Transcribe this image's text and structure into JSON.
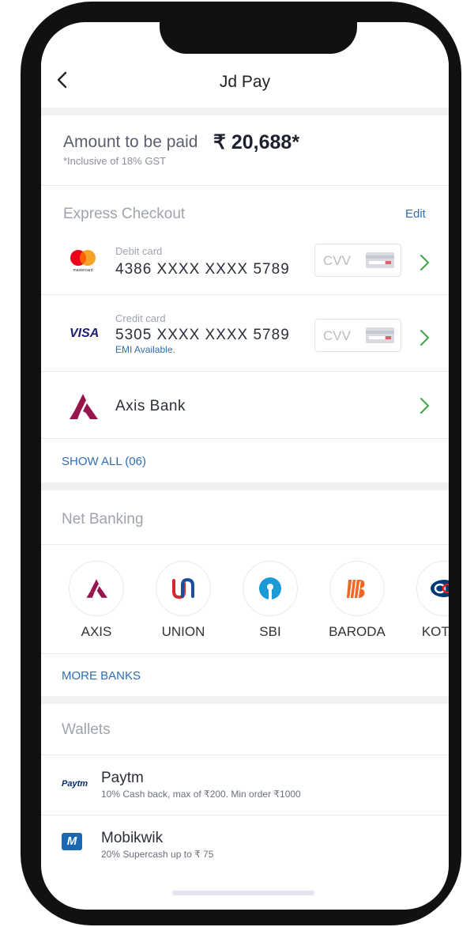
{
  "header": {
    "title": "Jd Pay"
  },
  "amount": {
    "label": "Amount to be paid",
    "value": "₹ 20,688*",
    "note": "*Inclusive of 18% GST"
  },
  "express_checkout": {
    "title": "Express Checkout",
    "edit_label": "Edit",
    "cards": [
      {
        "type": "Debit card",
        "number": "4386 XXXX XXXX 5789",
        "cvv_placeholder": "CVV",
        "network_icon": "mastercard-icon",
        "network_caption": "mastercard"
      },
      {
        "type": "Credit card",
        "number": "5305 XXXX XXXX 5789",
        "cvv_placeholder": "CVV",
        "emi": "EMI Available.",
        "network_icon": "visa-icon",
        "network_label": "VISA"
      }
    ],
    "bank": {
      "name": "Axis Bank",
      "icon": "axis-bank-icon"
    },
    "show_all": "SHOW ALL (06)"
  },
  "net_banking": {
    "title": "Net Banking",
    "banks": [
      {
        "label": "AXIS",
        "icon": "axis-logo-icon"
      },
      {
        "label": "UNION",
        "icon": "union-logo-icon"
      },
      {
        "label": "SBI",
        "icon": "sbi-logo-icon"
      },
      {
        "label": "BARODA",
        "icon": "baroda-logo-icon"
      },
      {
        "label": "KOTAK",
        "icon": "kotak-logo-icon"
      }
    ],
    "more_banks": "MORE BANKS"
  },
  "wallets": {
    "title": "Wallets",
    "items": [
      {
        "name": "Paytm",
        "desc": "10% Cash back, max of ₹200. Min order ₹1000",
        "logo_text": "Paytm",
        "icon": "paytm-logo-icon"
      },
      {
        "name": "Mobikwik",
        "desc": "20% Supercash up to ₹ 75",
        "logo_text": "M",
        "icon": "mobikwik-logo-icon"
      }
    ]
  },
  "colors": {
    "link_blue": "#2f6db3",
    "chevron_green": "#3aa845",
    "axis_maroon": "#97144d",
    "sbi_blue": "#1a9ad6",
    "baroda_orange": "#f26522",
    "union_red": "#d7282f",
    "union_blue": "#1c4c9c",
    "kotak_navy": "#003874",
    "kotak_red": "#ed1c24"
  }
}
